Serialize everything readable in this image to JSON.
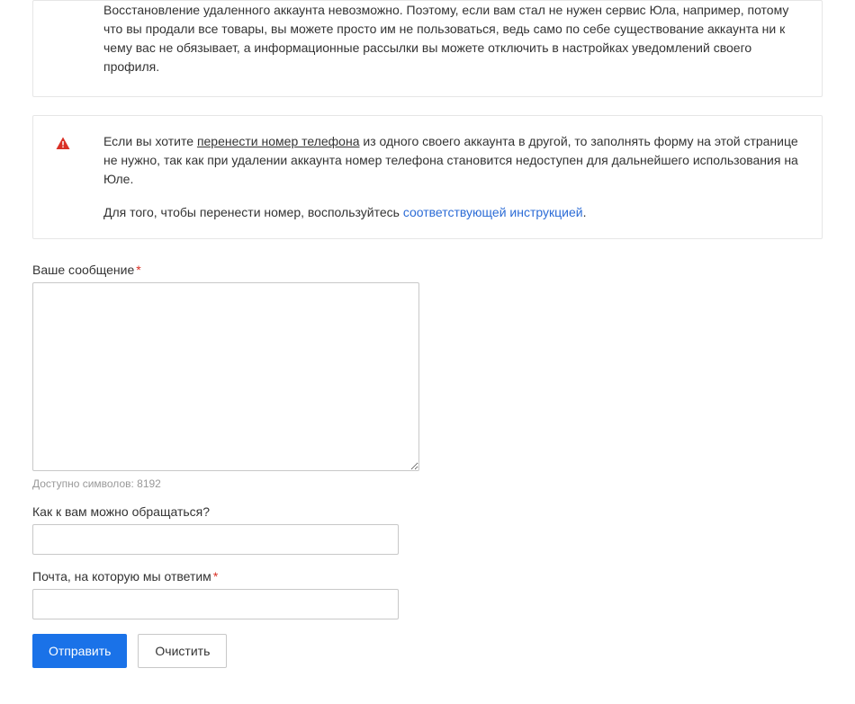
{
  "info": {
    "text": "Восстановление удаленного аккаунта невозможно. Поэтому, если вам стал не нужен сервис Юла, например, потому что вы продали все товары, вы можете просто им не пользоваться, ведь само по себе существование аккаунта ни к чему вас не обязывает, а информационные рассылки вы можете отключить в настройках уведомлений своего профиля."
  },
  "warning": {
    "p1_before": "Если вы хотите ",
    "p1_underline": "перенести номер телефона",
    "p1_after": " из одного своего аккаунта в другой, то заполнять форму на этой странице не нужно, так как при удалении аккаунта номер телефона становится недоступен для дальнейшего использования на Юле.",
    "p2_before": "Для того, чтобы перенести номер, воспользуйтесь ",
    "p2_link": "соответствующей инструкцией",
    "p2_after": "."
  },
  "form": {
    "message_label": "Ваше сообщение",
    "char_counter": "Доступно символов: 8192",
    "name_label": "Как к вам можно обращаться?",
    "email_label": "Почта, на которую мы ответим",
    "required_mark": "*",
    "submit_label": "Отправить",
    "clear_label": "Очистить"
  }
}
